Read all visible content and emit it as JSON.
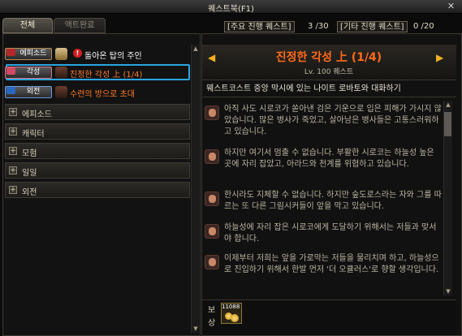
{
  "window": {
    "title": "퀘스트북(F1)",
    "close": "✕"
  },
  "tabs": {
    "all": "전체",
    "done": "액트완료"
  },
  "quests": [
    {
      "badge": "에피소드",
      "badge_color": "#b5282a",
      "icon": "book-icon",
      "title": "돌아온 탑의 주인",
      "title_color": "#ffffff",
      "mark": "!"
    },
    {
      "badge": "각성",
      "badge_color": "#d04a63",
      "icon": "character-portrait-icon",
      "title": "진정한 각성 上 (1/4)",
      "title_color": "#ff7a2a"
    },
    {
      "badge": "외전",
      "badge_color": "#2a67c0",
      "icon": "character-portrait-icon",
      "title": "수련의 방으로 초대",
      "title_color": "#ff7a2a"
    }
  ],
  "categories": [
    "에피소드",
    "캐릭터",
    "모험",
    "일일",
    "외전"
  ],
  "counters": {
    "main_label": "[주요 진행 퀘스트]",
    "main_value": "3 /30",
    "other_label": "[기타 진행 퀘스트]",
    "other_value": "0 /20"
  },
  "detail": {
    "name": "진정한 각성 上 (1/4)",
    "level": "Lv. 100 퀘스트",
    "objective": "웨스트코스트 중앙 막시에 있는 나이트 로바토와 대화하기",
    "dialogue": [
      "아직 사도 시로코가 쏟아낸 검은 기운으로 입은 피해가 가시지 않았습니다. 많은 병사가 죽었고, 살아남은 병사들은 고통스러워하고 있습니다.",
      "하지만 여기서 멈출 수 없습니다. 부활한 시로코는 하늘성 높은 곳에 자리 잡았고, 아라드와 천계를 위협하고 있습니다.",
      "한시라도 지체할 수 없습니다. 하지만 숲도로스라는 자와 그를 따르는 또 다른 그림시커들이 앞을 막고 있습니다.",
      "하늘성에 자리 잡은 시로코에게 도달하기 위해서는 저들과 맞서야 합니다.",
      "이제부터 저희는 앞을 가로막는 저들을 물리치며 하고, 하늘성으로 진입하기 위해서 한발 먼저 '더 오큘러스'로 향할 생각입니다."
    ]
  },
  "reward": {
    "label": "보상",
    "count": "11088",
    "icon": "gold-coins-icon"
  },
  "colors": {
    "selection": "#2aa6e0",
    "accent": "#ff6a1a",
    "arrow": "#f0b020"
  }
}
